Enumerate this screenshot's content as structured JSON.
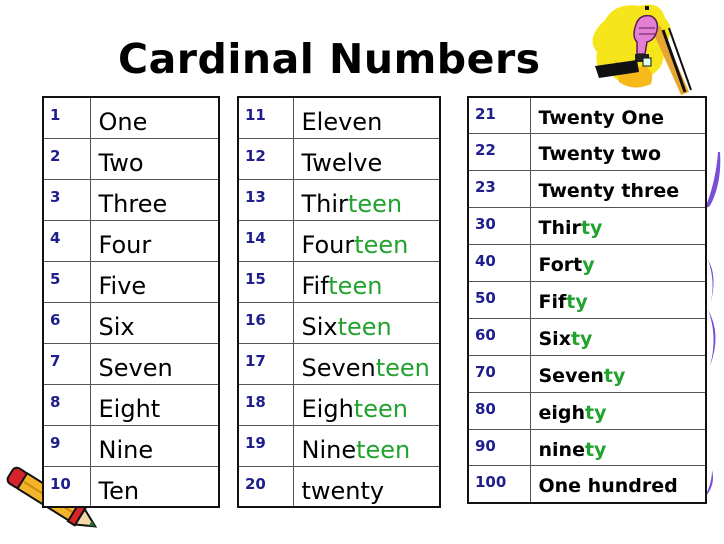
{
  "title": "Cardinal Numbers",
  "colors": {
    "number_text": "#1e1e8c",
    "word_text": "#000000",
    "suffix_highlight": "#22a22e",
    "border": "#111111"
  },
  "tables": [
    {
      "rows": [
        {
          "num": "1",
          "base": "One",
          "suffix": ""
        },
        {
          "num": "2",
          "base": "Two",
          "suffix": ""
        },
        {
          "num": "3",
          "base": "Three",
          "suffix": ""
        },
        {
          "num": "4",
          "base": "Four",
          "suffix": ""
        },
        {
          "num": "5",
          "base": "Five",
          "suffix": ""
        },
        {
          "num": "6",
          "base": "Six",
          "suffix": ""
        },
        {
          "num": "7",
          "base": "Seven",
          "suffix": ""
        },
        {
          "num": "8",
          "base": "Eight",
          "suffix": ""
        },
        {
          "num": "9",
          "base": "Nine",
          "suffix": ""
        },
        {
          "num": "10",
          "base": "Ten",
          "suffix": ""
        }
      ]
    },
    {
      "rows": [
        {
          "num": "11",
          "base": "Eleven",
          "suffix": ""
        },
        {
          "num": "12",
          "base": "Twelve",
          "suffix": ""
        },
        {
          "num": "13",
          "base": "Thir",
          "suffix": "teen"
        },
        {
          "num": "14",
          "base": "Four",
          "suffix": "teen"
        },
        {
          "num": "15",
          "base": "Fif",
          "suffix": "teen"
        },
        {
          "num": "16",
          "base": "Six",
          "suffix": "teen"
        },
        {
          "num": "17",
          "base": "Seven",
          "suffix": "teen"
        },
        {
          "num": "18",
          "base": "Eigh",
          "suffix": "teen"
        },
        {
          "num": "19",
          "base": "Nine",
          "suffix": "teen"
        },
        {
          "num": "20",
          "base": "twenty",
          "suffix": ""
        }
      ]
    },
    {
      "rows": [
        {
          "num": "21",
          "base": "Twenty One",
          "suffix": ""
        },
        {
          "num": "22",
          "base": "Twenty two",
          "suffix": ""
        },
        {
          "num": "23",
          "base": "Twenty three",
          "suffix": ""
        },
        {
          "num": "30",
          "base": "Thir",
          "suffix": "ty"
        },
        {
          "num": "40",
          "base": "Fort",
          "suffix": "y"
        },
        {
          "num": "50",
          "base": "Fif",
          "suffix": "ty"
        },
        {
          "num": "60",
          "base": "Six",
          "suffix": "ty"
        },
        {
          "num": "70",
          "base": "Seven",
          "suffix": "ty"
        },
        {
          "num": "80",
          "base": "eigh",
          "suffix": "ty"
        },
        {
          "num": "90",
          "base": "nine",
          "suffix": "ty"
        },
        {
          "num": "100",
          "base": "One hundred",
          "suffix": ""
        }
      ]
    }
  ],
  "decorations": {
    "top_right": "fist-clipart-icon",
    "bottom_left": "pencil-clipart-icon",
    "right_edge": "purple-brush-strokes"
  }
}
